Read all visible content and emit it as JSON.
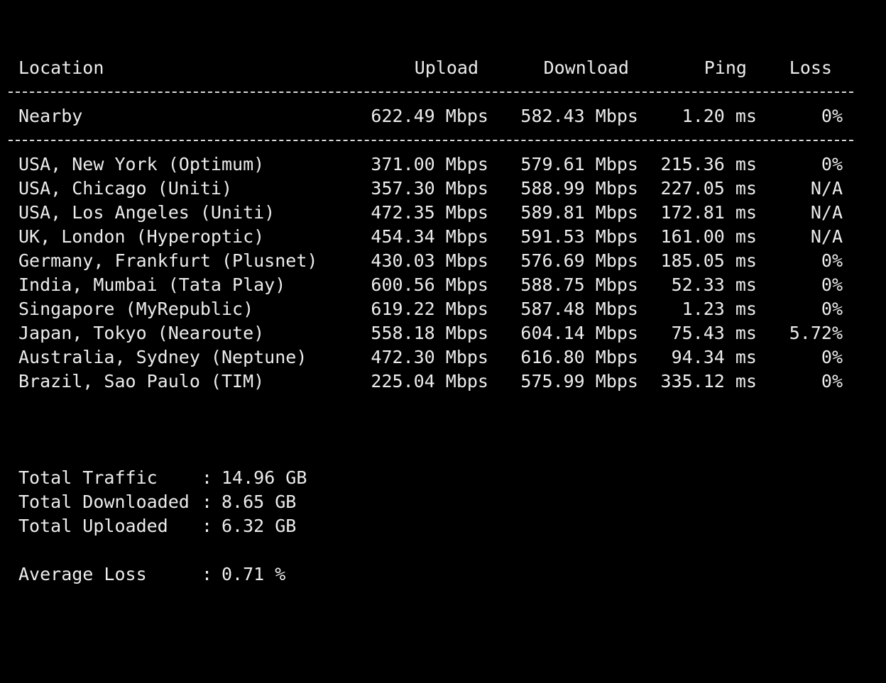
{
  "header": {
    "location": "Location",
    "upload": "Upload",
    "download": "Download",
    "ping": "Ping",
    "loss": "Loss"
  },
  "nearby": {
    "location": "Nearby",
    "upload": "622.49 Mbps",
    "download": "582.43 Mbps",
    "ping": "1.20 ms",
    "loss": "0%"
  },
  "rows": [
    {
      "location": "USA, New York (Optimum)",
      "upload": "371.00 Mbps",
      "download": "579.61 Mbps",
      "ping": "215.36 ms",
      "loss": "0%"
    },
    {
      "location": "USA, Chicago (Uniti)",
      "upload": "357.30 Mbps",
      "download": "588.99 Mbps",
      "ping": "227.05 ms",
      "loss": "N/A"
    },
    {
      "location": "USA, Los Angeles (Uniti)",
      "upload": "472.35 Mbps",
      "download": "589.81 Mbps",
      "ping": "172.81 ms",
      "loss": "N/A"
    },
    {
      "location": "UK, London (Hyperoptic)",
      "upload": "454.34 Mbps",
      "download": "591.53 Mbps",
      "ping": "161.00 ms",
      "loss": "N/A"
    },
    {
      "location": "Germany, Frankfurt (Plusnet)",
      "upload": "430.03 Mbps",
      "download": "576.69 Mbps",
      "ping": "185.05 ms",
      "loss": "0%"
    },
    {
      "location": "India, Mumbai (Tata Play)",
      "upload": "600.56 Mbps",
      "download": "588.75 Mbps",
      "ping": "52.33 ms",
      "loss": "0%"
    },
    {
      "location": "Singapore (MyRepublic)",
      "upload": "619.22 Mbps",
      "download": "587.48 Mbps",
      "ping": "1.23 ms",
      "loss": "0%"
    },
    {
      "location": "Japan, Tokyo (Nearoute)",
      "upload": "558.18 Mbps",
      "download": "604.14 Mbps",
      "ping": "75.43 ms",
      "loss": "5.72%"
    },
    {
      "location": "Australia, Sydney (Neptune)",
      "upload": "472.30 Mbps",
      "download": "616.80 Mbps",
      "ping": "94.34 ms",
      "loss": "0%"
    },
    {
      "location": "Brazil, Sao Paulo (TIM)",
      "upload": "225.04 Mbps",
      "download": "575.99 Mbps",
      "ping": "335.12 ms",
      "loss": "0%"
    }
  ],
  "summary": {
    "total_traffic": {
      "label": "Total Traffic",
      "separator": ":",
      "value": "14.96 GB"
    },
    "total_downloaded": {
      "label": "Total Downloaded",
      "separator": ":",
      "value": "8.65 GB"
    },
    "total_uploaded": {
      "label": "Total Uploaded",
      "separator": ":",
      "value": "6.32 GB"
    },
    "average_loss": {
      "label": "Average Loss",
      "separator": ":",
      "value": "0.71 %"
    }
  },
  "colors": {
    "background": "#000000",
    "text": "#ececec"
  }
}
